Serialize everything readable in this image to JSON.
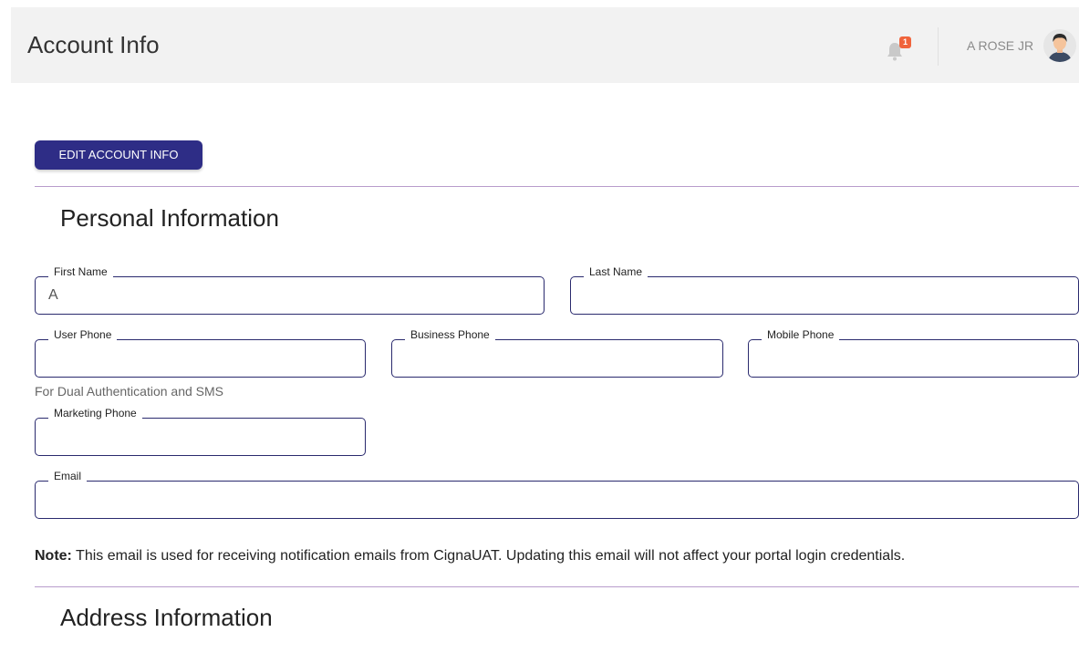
{
  "header": {
    "title": "Account Info",
    "notification_count": "1",
    "user_name": "A ROSE JR"
  },
  "actions": {
    "edit_label": "EDIT ACCOUNT INFO"
  },
  "personal": {
    "title": "Personal Information",
    "first_name": {
      "label": "First Name",
      "value": "A"
    },
    "last_name": {
      "label": "Last Name",
      "value": ""
    },
    "user_phone": {
      "label": "User Phone",
      "value": "",
      "helper": "For Dual Authentication and SMS"
    },
    "business_phone": {
      "label": "Business Phone",
      "value": ""
    },
    "mobile_phone": {
      "label": "Mobile Phone",
      "value": ""
    },
    "marketing_phone": {
      "label": "Marketing Phone",
      "value": ""
    },
    "email": {
      "label": "Email",
      "value": ""
    },
    "note_prefix": "Note:",
    "note_text": " This email is used for receiving notification emails from CignaUAT. Updating this email will not affect your portal login credentials."
  },
  "address": {
    "title": "Address Information"
  },
  "colors": {
    "primary": "#2e2d86",
    "badge": "#f0643c",
    "rule": "#b89ccc"
  }
}
